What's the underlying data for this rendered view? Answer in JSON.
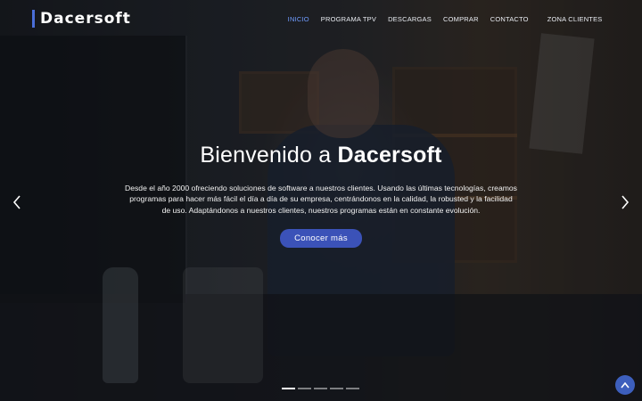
{
  "brand": {
    "name": "Dacersoft",
    "accent": "#4a6ed8"
  },
  "nav": {
    "items": [
      {
        "label": "INICIO",
        "active": true
      },
      {
        "label": "PROGRAMA TPV",
        "active": false
      },
      {
        "label": "DESCARGAS",
        "active": false
      },
      {
        "label": "COMPRAR",
        "active": false
      },
      {
        "label": "CONTACTO",
        "active": false
      },
      {
        "label": "ZONA CLIENTES",
        "active": false
      }
    ],
    "active_color": "#6f9cff"
  },
  "hero": {
    "title_prefix": "Bienvenido a ",
    "title_brand": "Dacersoft",
    "lead": "Desde el año 2000 ofreciendo soluciones de software a nuestros clientes. Usando las últimas tecnologías, creamos programas para hacer más fácil el día a día de su empresa, centrándonos en la calidad, la robusted y la facilidad de uso. Adaptándonos a nuestros clientes, nuestros programas están en constante evolución.",
    "cta_label": "Conocer más",
    "cta_color": "#3b52b8"
  },
  "carousel": {
    "prev_icon": "chevron-left-icon",
    "next_icon": "chevron-right-icon",
    "slide_count": 5,
    "active_slide": 1
  },
  "back_to_top": {
    "icon": "chevron-up-icon",
    "color": "#3d5fbd"
  }
}
